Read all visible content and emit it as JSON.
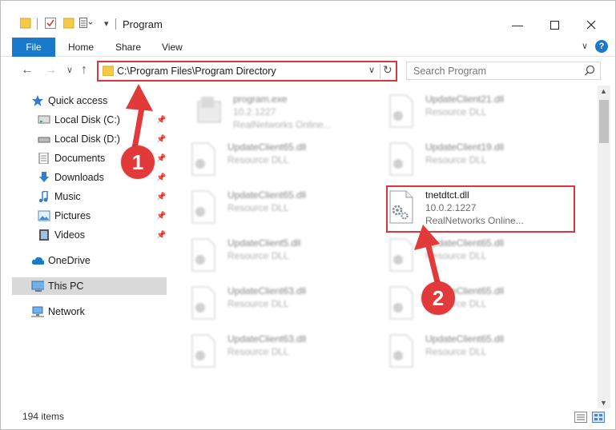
{
  "window": {
    "title": "Program",
    "accent_color": "#1979ca",
    "highlight_color": "#d9363e"
  },
  "ribbon": {
    "tabs": [
      "File",
      "Home",
      "Share",
      "View"
    ]
  },
  "address_bar": {
    "path": "C:\\Program Files\\Program Directory"
  },
  "search": {
    "placeholder": "Search Program"
  },
  "sidebar": {
    "items": [
      {
        "label": "Quick access",
        "icon": "star-icon"
      },
      {
        "label": "Local Disk (C:)",
        "icon": "drive-icon"
      },
      {
        "label": "Local Disk (D:)",
        "icon": "drive-icon"
      },
      {
        "label": "Documents",
        "icon": "documents-icon"
      },
      {
        "label": "Downloads",
        "icon": "download-icon"
      },
      {
        "label": "Music",
        "icon": "music-icon"
      },
      {
        "label": "Pictures",
        "icon": "pictures-icon"
      },
      {
        "label": "Videos",
        "icon": "videos-icon"
      },
      {
        "label": "OneDrive",
        "icon": "cloud-icon"
      },
      {
        "label": "This PC",
        "icon": "computer-icon"
      },
      {
        "label": "Network",
        "icon": "network-icon"
      }
    ]
  },
  "files": {
    "left": [
      {
        "name": "program.exe",
        "meta1": "10.2.1227",
        "meta2": "RealNetworks Online..."
      },
      {
        "name": "UpdateClient65.dll",
        "meta1": "Resource DLL"
      },
      {
        "name": "UpdateClient65.dll",
        "meta1": "Resource DLL"
      },
      {
        "name": "UpdateClient5.dll",
        "meta1": "Resource DLL"
      },
      {
        "name": "UpdateClient63.dll",
        "meta1": "Resource DLL"
      },
      {
        "name": "UpdateClient63.dll",
        "meta1": "Resource DLL"
      }
    ],
    "right": [
      {
        "name": "UpdateClient21.dll",
        "meta1": "Resource DLL"
      },
      {
        "name": "UpdateClient19.dll",
        "meta1": "Resource DLL"
      },
      {
        "name": "tnetdtct.dll",
        "meta1": "10.0.2.1227",
        "meta2": "RealNetworks Online..."
      },
      {
        "name": "UpdateClient65.dll",
        "meta1": "Resource DLL"
      },
      {
        "name": "UpdateClient65.dll",
        "meta1": "Resource DLL"
      },
      {
        "name": "UpdateClient65.dll",
        "meta1": "Resource DLL"
      }
    ]
  },
  "status": {
    "item_count": "194 items"
  },
  "annotations": {
    "step1": "1",
    "step2": "2"
  }
}
